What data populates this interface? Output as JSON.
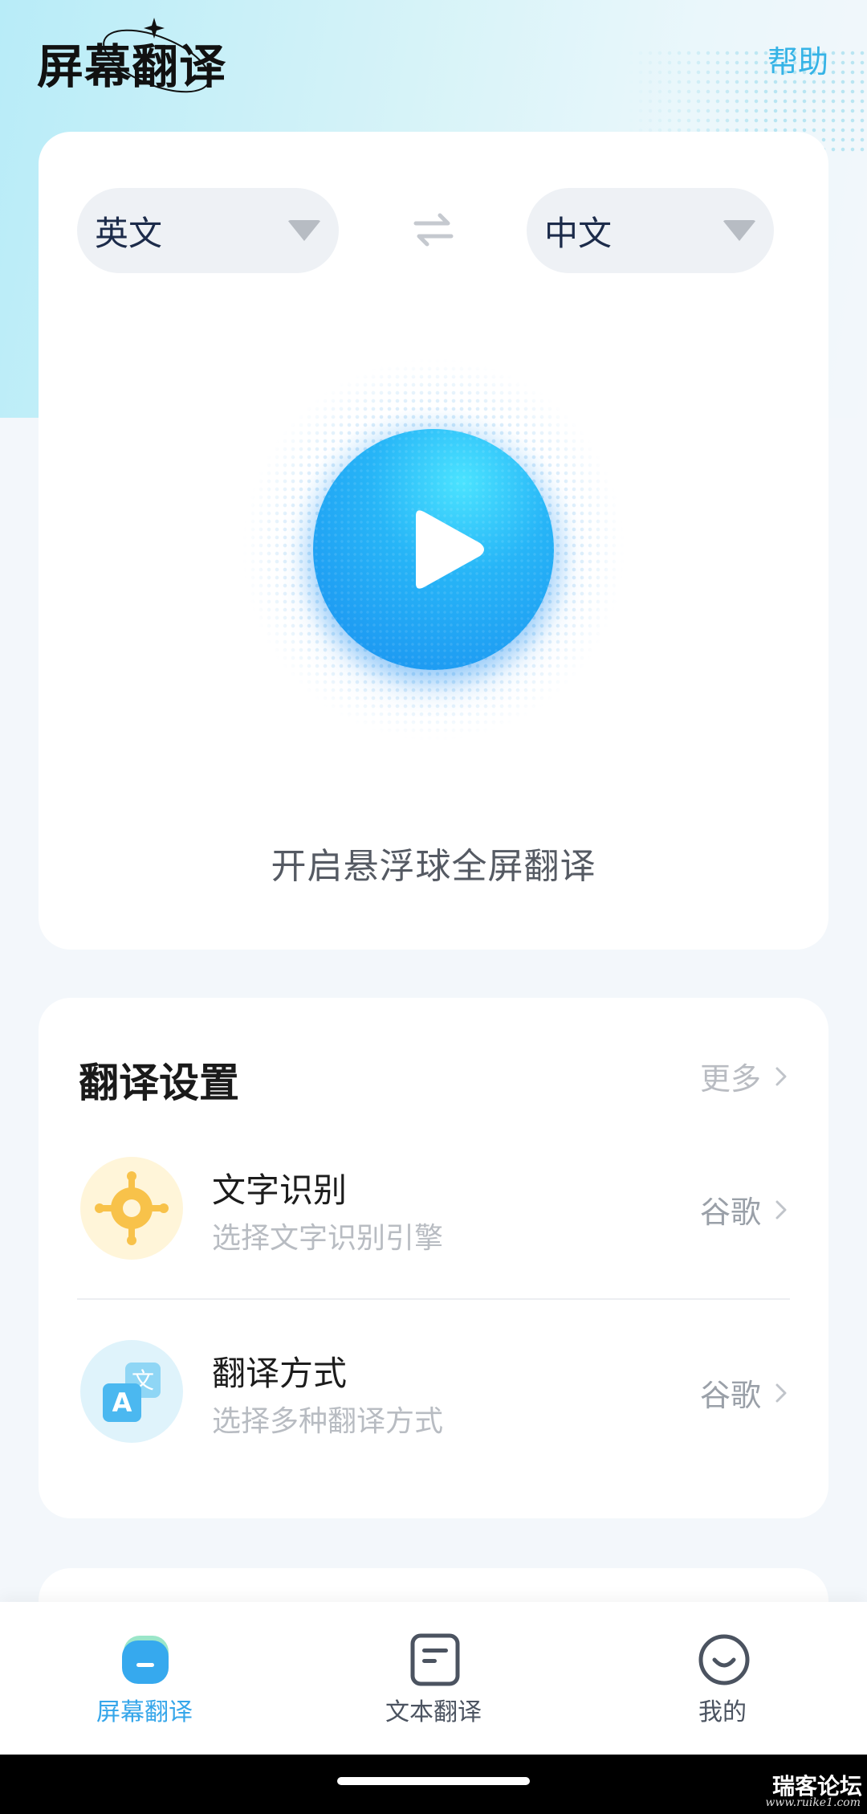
{
  "header": {
    "title": "屏幕翻译",
    "help_label": "帮助"
  },
  "translate_card": {
    "source_language": "英文",
    "target_language": "中文",
    "swap_icon": "swap-arrows-icon",
    "play_icon": "play-icon",
    "start_caption": "开启悬浮球全屏翻译"
  },
  "settings": {
    "title": "翻译设置",
    "more_label": "更多",
    "rows": [
      {
        "title": "文字识别",
        "subtitle": "选择文字识别引擎",
        "value": "谷歌",
        "icon": "target-crosshair-icon",
        "icon_color": "#f8c24a"
      },
      {
        "title": "翻译方式",
        "subtitle": "选择多种翻译方式",
        "value": "谷歌",
        "icon": "translate-icon",
        "icon_color": "#5cc4f2"
      }
    ]
  },
  "tabbar": {
    "tabs": [
      {
        "label": "屏幕翻译",
        "icon": "screen-translate-icon",
        "active": true
      },
      {
        "label": "文本翻译",
        "icon": "document-icon",
        "active": false
      },
      {
        "label": "我的",
        "icon": "smiley-face-icon",
        "active": false
      }
    ]
  },
  "watermark": {
    "name": "瑞客论坛",
    "url": "www.ruike1.com"
  },
  "colors": {
    "accent": "#35b3e6",
    "play_button": "#1f9cf3",
    "active_tab": "#35a6ea"
  }
}
